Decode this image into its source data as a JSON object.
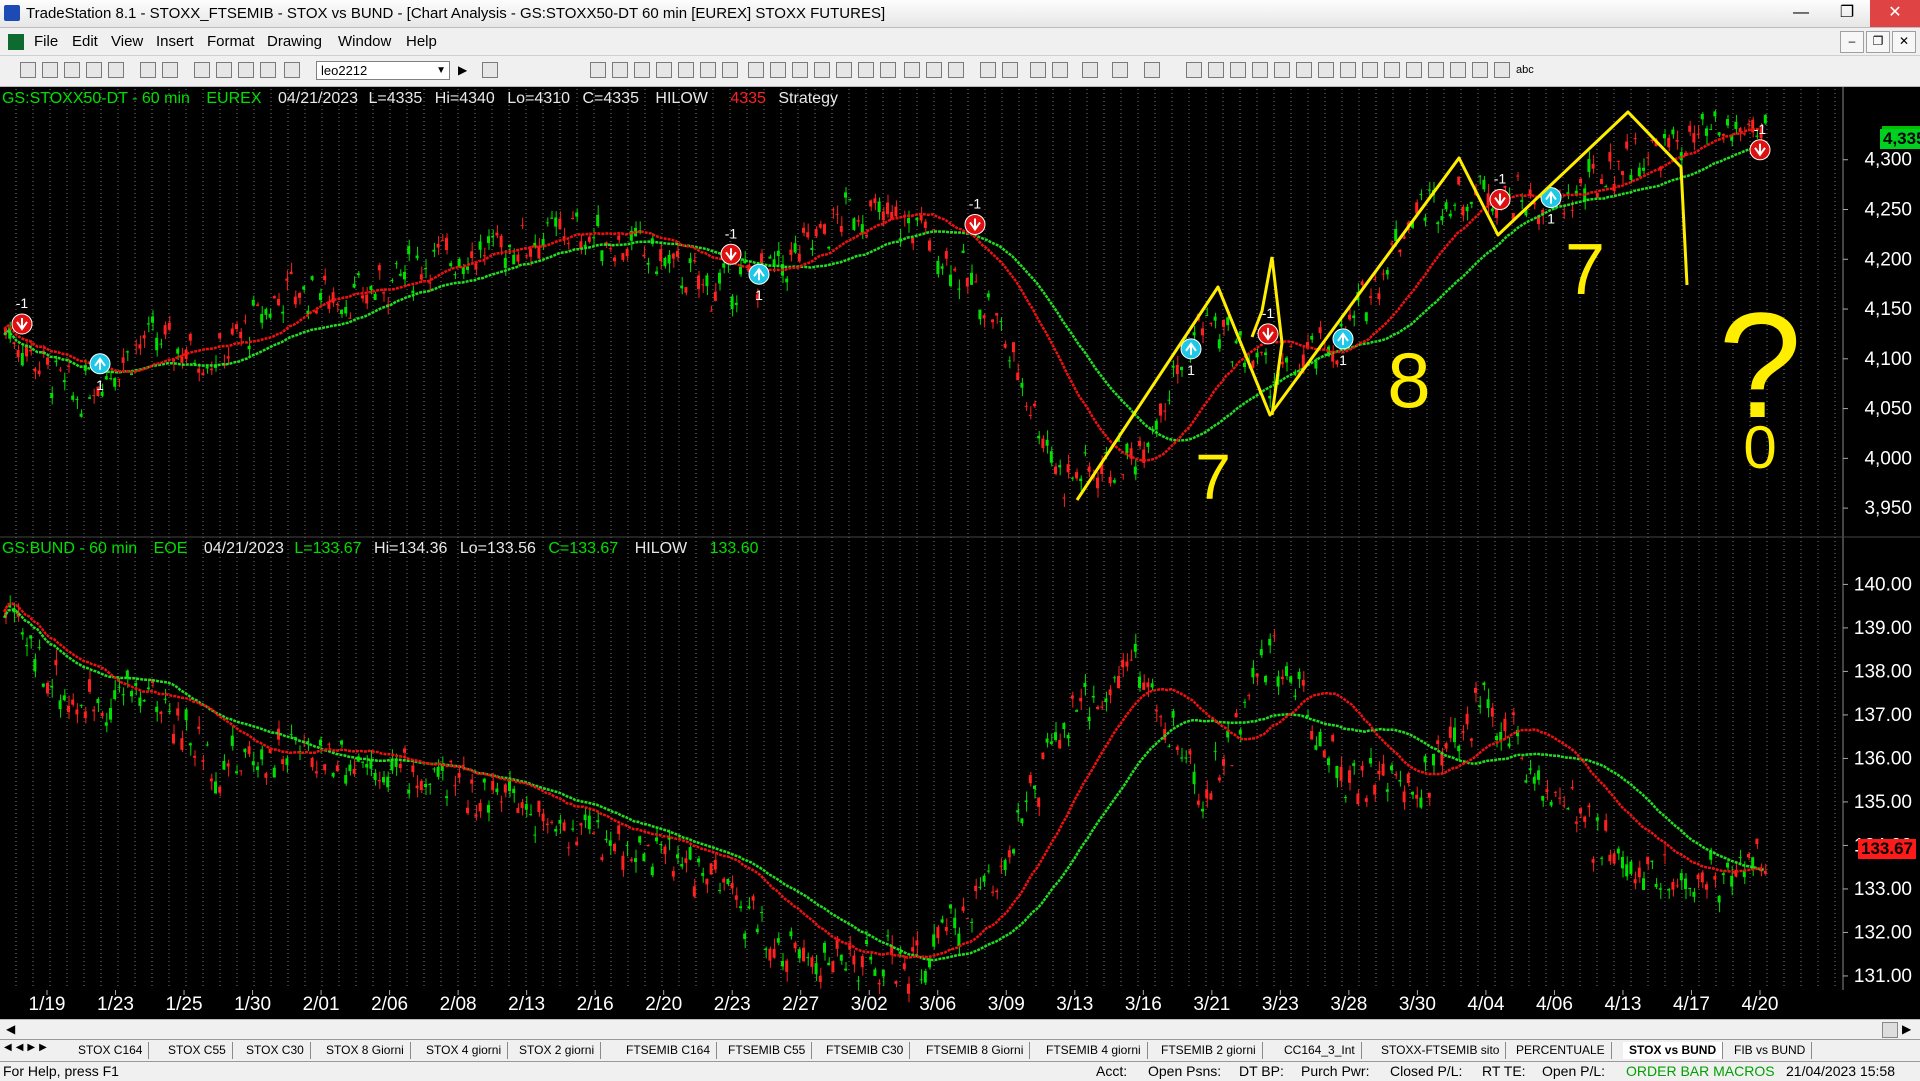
{
  "window": {
    "title": "TradeStation 8.1 - STOXX_FTSEMIB - STOX vs BUND - [Chart Analysis - GS:STOXX50-DT  60 min  [EUREX] STOXX FUTURES]"
  },
  "menu": [
    "File",
    "Edit",
    "View",
    "Insert",
    "Format",
    "Drawing",
    "Window",
    "Help"
  ],
  "toolbar": {
    "symbol_combo": "leo2212"
  },
  "colors": {
    "up": "#00e000",
    "down": "#ff2020",
    "lowline": "#22dd22",
    "highline": "#ee1111",
    "drawing": "#ffee00",
    "bg": "#000000",
    "grid": "#777777"
  },
  "pane1": {
    "header": {
      "symbol": "GS:STOXX50-DT - 60 min",
      "exchange": "EUREX",
      "date": "04/21/2023",
      "last": "L=4335",
      "hi": "Hi=4340",
      "lo": "Lo=4310",
      "close": "C=4335",
      "study": "HILOW",
      "study_value": "4335",
      "strategy": "Strategy"
    },
    "last_price": "4,335",
    "y_labels": [
      "4,300",
      "4,250",
      "4,200",
      "4,150",
      "4,100",
      "4,050",
      "4,000",
      "3,950"
    ],
    "signal_labels": {
      "sell": "-1",
      "buy": "1"
    },
    "annotations": [
      "7",
      "8",
      "7",
      "?",
      "0"
    ]
  },
  "pane2": {
    "header": {
      "symbol": "GS:BUND - 60 min",
      "exchange": "EOE",
      "date": "04/21/2023",
      "last": "L=133.67",
      "hi": "Hi=134.36",
      "lo": "Lo=133.56",
      "close": "C=133.67",
      "study": "HILOW",
      "study_value": "133.60"
    },
    "last_price": "133.67",
    "y_labels": [
      "140.00",
      "139.00",
      "138.00",
      "137.00",
      "136.00",
      "135.00",
      "134.00",
      "133.00",
      "132.00",
      "131.00"
    ]
  },
  "x_labels": [
    "1/19",
    "1/23",
    "1/25",
    "1/30",
    "2/01",
    "2/06",
    "2/08",
    "2/13",
    "2/16",
    "2/20",
    "2/23",
    "2/27",
    "3/02",
    "3/06",
    "3/09",
    "3/13",
    "3/16",
    "3/21",
    "3/23",
    "3/28",
    "3/30",
    "4/04",
    "4/06",
    "4/13",
    "4/17",
    "4/20"
  ],
  "chart_data": [
    {
      "type": "line",
      "title": "GS:STOXX50-DT - 60 min",
      "x": [
        "1/19",
        "1/23",
        "1/25",
        "1/30",
        "2/01",
        "2/06",
        "2/08",
        "2/13",
        "2/16",
        "2/20",
        "2/23",
        "2/27",
        "3/02",
        "3/06",
        "3/09",
        "3/13",
        "3/16",
        "3/21",
        "3/23",
        "3/28",
        "3/30",
        "4/04",
        "4/06",
        "4/13",
        "4/17",
        "4/20"
      ],
      "values": [
        4130,
        4060,
        4120,
        4100,
        4170,
        4160,
        4200,
        4210,
        4230,
        4210,
        4170,
        4190,
        4250,
        4230,
        4150,
        3980,
        4000,
        4140,
        4080,
        4120,
        4250,
        4270,
        4250,
        4300,
        4320,
        4335
      ],
      "ylim": [
        3925,
        4355
      ]
    },
    {
      "type": "line",
      "title": "GS:BUND - 60 min",
      "x": [
        "1/19",
        "1/23",
        "1/25",
        "1/30",
        "2/01",
        "2/06",
        "2/08",
        "2/13",
        "2/16",
        "2/20",
        "2/23",
        "2/27",
        "3/02",
        "3/06",
        "3/09",
        "3/13",
        "3/16",
        "3/21",
        "3/23",
        "3/28",
        "3/30",
        "4/04",
        "4/06",
        "4/13",
        "4/17",
        "4/20"
      ],
      "values": [
        139.2,
        137.2,
        137.6,
        135.8,
        136.2,
        136.0,
        135.5,
        135.2,
        134.4,
        133.9,
        133.3,
        131.6,
        131.3,
        131.2,
        133.2,
        136.6,
        138.3,
        135.0,
        138.5,
        135.7,
        135.2,
        137.4,
        135.1,
        133.5,
        133.2,
        133.7
      ],
      "ylim": [
        130.7,
        140.4
      ]
    }
  ],
  "tabs": [
    "STOX C164",
    "STOX C55",
    "STOX  C30",
    "STOX  8 Giorni",
    "STOX 4 giorni",
    "STOX  2 giorni",
    "FTSEMIB C164",
    "FTSEMIB C55",
    "FTSEMIB C30",
    "FTSEMIB  8 Giorni",
    "FTSEMIB  4 giorni",
    "FTSEMIB  2 giorni",
    "CC164_3_Int",
    "STOXX-FTSEMIB sito",
    "PERCENTUALE",
    "STOX vs BUND",
    "FIB vs BUND"
  ],
  "active_tab": "STOX vs BUND",
  "status": {
    "help": "For Help, press F1",
    "acct": "Acct:",
    "open_psns": "Open Psns:",
    "dt_bp": "DT BP:",
    "purch_pwr": "Purch Pwr:",
    "closed_pl": "Closed P/L:",
    "rt_te": "RT TE:",
    "open_pl": "Open P/L:",
    "macros": "ORDER BAR  MACROS",
    "datetime": "21/04/2023 15:58"
  }
}
